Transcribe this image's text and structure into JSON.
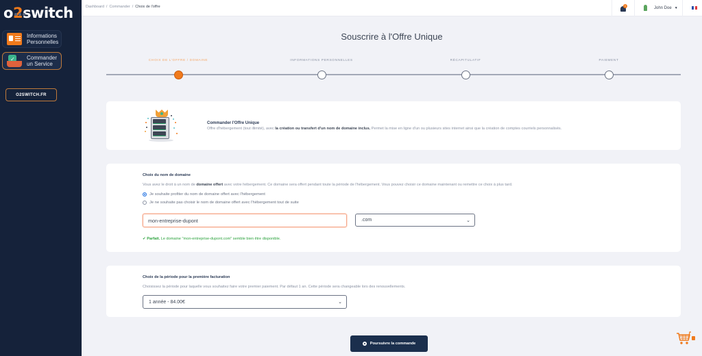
{
  "sidebar": {
    "logo": {
      "pre": "o",
      "two": "2",
      "post": "switch"
    },
    "items": [
      {
        "label_line1": "Informations",
        "label_line2": "Personnelles",
        "icon": "id-card-icon",
        "active": false
      },
      {
        "label_line1": "Commander",
        "label_line2": "un Service",
        "icon": "shopping-basket-icon",
        "active": true
      }
    ],
    "site_link": "O2SWITCH.FR"
  },
  "topbar": {
    "breadcrumb": [
      "Dashboard",
      "Commander",
      "Choix de l'offre"
    ],
    "notifications_count": "1",
    "user_name": "John Doe",
    "language_flag": "fr-flag-icon"
  },
  "page": {
    "title": "Souscrire à l'Offre Unique"
  },
  "stepper": {
    "current_step": 1,
    "steps": [
      {
        "label": "CHOIX DE L'OFFRE / DOMAINE"
      },
      {
        "label": "INFORMATIONS PERSONNELLES"
      },
      {
        "label": "RÉCAPITULATIF"
      },
      {
        "label": "PAIEMENT"
      }
    ]
  },
  "offer": {
    "title": "Commander l'Offre Unique",
    "desc_pre": "Offre d'hébergement (tout illimité), avec ",
    "desc_bold": "la création ou transfert d'un nom de domaine inclus.",
    "desc_post": " Permet la mise en ligne d'un ou plusieurs sites internet ainsi que la création de comptes courriels personnalisés."
  },
  "domain": {
    "title": "Choix du nom de domaine",
    "desc_pre": "Vous avez le droit à un nom de ",
    "desc_bold": "domaine offert",
    "desc_post": " avec votre hébergement. Ce domaine sera offert pendant toute la période de l'hébergement. Vous pouvez choisir ce domaine maintenant ou remettre ce choix à plus tard.",
    "options": [
      {
        "label": "Je souhaite profiter du nom de domaine offert avec l'hébergement",
        "checked": true
      },
      {
        "label": "Je ne souhaite pas choisir le nom de domaine offert avec l'hébergement tout de suite",
        "checked": false
      }
    ],
    "input_value": "mon-entreprise-dupont",
    "extension_selected": ".com",
    "availability_bold": "Parfait.",
    "availability_text": " Le domaine \"mon-entreprise-dupont.com\" semble bien être disponible."
  },
  "billing": {
    "title": "Choix de la période pour la première facturation",
    "desc": "Choisissez la période pour laquelle vous souhaitez faire votre premier paiement. Par défaut 1 an. Cette période sera changeable lors des renouvellements.",
    "period_selected": "1 année - 84.00€"
  },
  "actions": {
    "submit_label": "Poursuivre la commande"
  },
  "cart": {
    "count": "0"
  },
  "colors": {
    "accent": "#f07a1c",
    "sidebar_bg": "#15223a",
    "primary_button": "#1b2f4d",
    "success": "#2ea33f"
  }
}
